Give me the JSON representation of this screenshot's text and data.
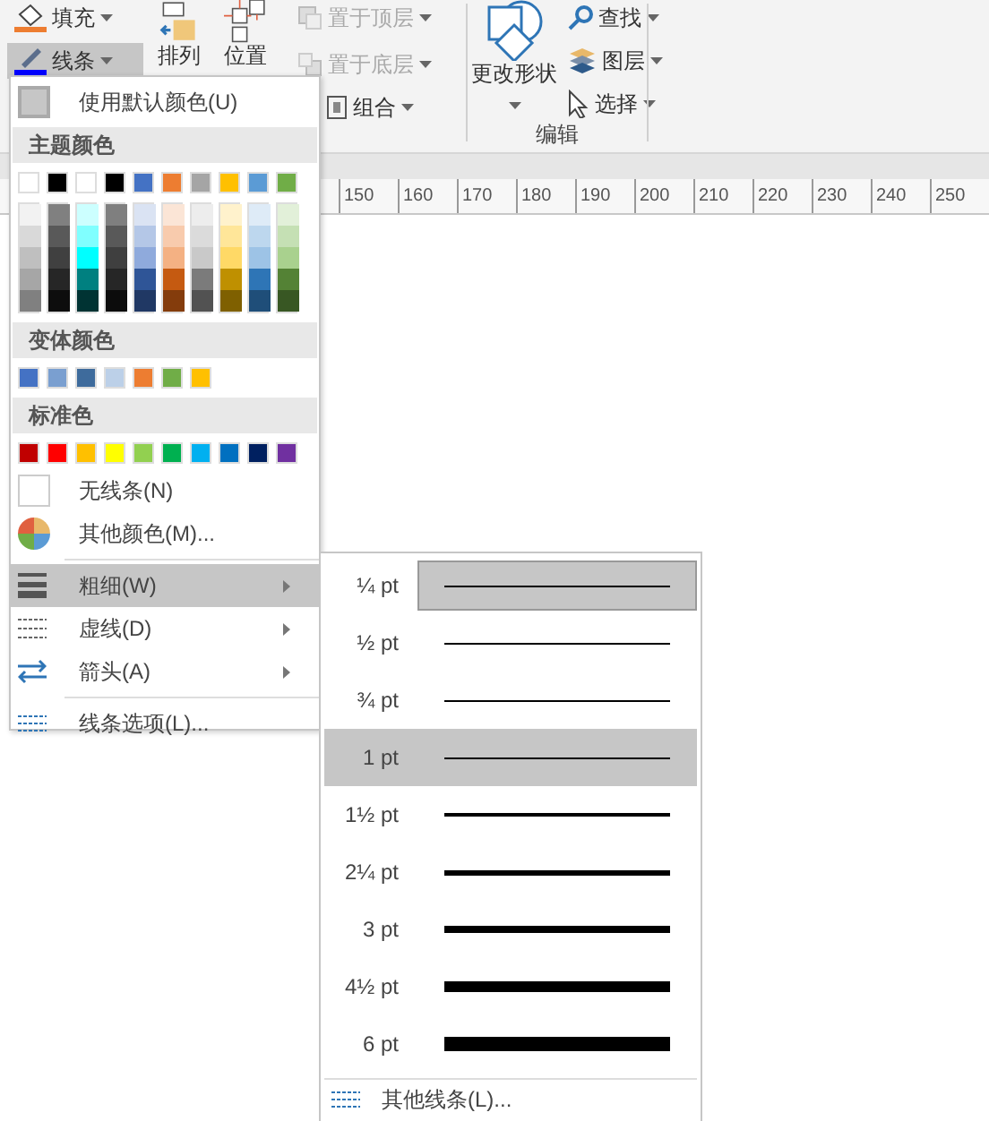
{
  "ribbon": {
    "format_buttons": [
      {
        "label": "填充",
        "kind": "fill",
        "selected": false
      },
      {
        "label": "线条",
        "kind": "line",
        "selected": true
      }
    ],
    "arrange_group": {
      "large_buttons": [
        {
          "label": "排列",
          "kind": "arrange"
        },
        {
          "label": "位置",
          "kind": "position"
        }
      ],
      "small_buttons": [
        {
          "label": "置于顶层",
          "kind": "front",
          "disabled": true
        },
        {
          "label": "置于底层",
          "kind": "back",
          "disabled": true
        },
        {
          "label": "组合",
          "kind": "group",
          "disabled": false
        }
      ]
    },
    "edit_group": {
      "label": "编辑",
      "large_button": {
        "label": "更改形状"
      },
      "small_buttons": [
        {
          "label": "查找",
          "kind": "find"
        },
        {
          "label": "图层",
          "kind": "layers"
        },
        {
          "label": "选择",
          "kind": "select"
        }
      ]
    }
  },
  "ruler": {
    "labels": [
      "150",
      "160",
      "170",
      "180",
      "190",
      "200",
      "210",
      "220",
      "230",
      "240",
      "250"
    ]
  },
  "line_menu": {
    "default_color": {
      "label": "使用默认颜色(U)"
    },
    "sections": [
      {
        "header": "主题颜色",
        "swatches": [
          {
            "color": "#ffffff"
          },
          {
            "color": "#000000"
          },
          {
            "color": "#ffffff"
          },
          {
            "color": "#000000"
          },
          {
            "color": "#4472c4"
          },
          {
            "color": "#ed7d31"
          },
          {
            "color": "#a5a5a5"
          },
          {
            "color": "#ffc000"
          },
          {
            "color": "#5b9bd5"
          },
          {
            "color": "#70ad47"
          }
        ],
        "shades": [
          {
            "swatches": [
              {
                "color": "#f2f2f2"
              },
              {
                "color": "#d9d9d9"
              },
              {
                "color": "#bfbfbf"
              },
              {
                "color": "#a6a6a6"
              },
              {
                "color": "#808080"
              }
            ]
          },
          {
            "swatches": [
              {
                "color": "#808080"
              },
              {
                "color": "#595959"
              },
              {
                "color": "#404040"
              },
              {
                "color": "#262626"
              },
              {
                "color": "#0d0d0d"
              }
            ]
          },
          {
            "swatches": [
              {
                "color": "#ccffff"
              },
              {
                "color": "#80ffff"
              },
              {
                "color": "#00ffff"
              },
              {
                "color": "#008080"
              },
              {
                "color": "#003333"
              }
            ]
          },
          {
            "swatches": [
              {
                "color": "#7f7f7f"
              },
              {
                "color": "#595959"
              },
              {
                "color": "#3f3f3f"
              },
              {
                "color": "#262626"
              },
              {
                "color": "#0c0c0c"
              }
            ]
          },
          {
            "swatches": [
              {
                "color": "#dae3f3"
              },
              {
                "color": "#b4c7e7"
              },
              {
                "color": "#8faadc"
              },
              {
                "color": "#2f5597"
              },
              {
                "color": "#203864"
              }
            ]
          },
          {
            "swatches": [
              {
                "color": "#fbe5d6"
              },
              {
                "color": "#f8cbad"
              },
              {
                "color": "#f4b183"
              },
              {
                "color": "#c55a11"
              },
              {
                "color": "#843c0c"
              }
            ]
          },
          {
            "swatches": [
              {
                "color": "#ededed"
              },
              {
                "color": "#dbdbdb"
              },
              {
                "color": "#c9c9c9"
              },
              {
                "color": "#7b7b7b"
              },
              {
                "color": "#525252"
              }
            ]
          },
          {
            "swatches": [
              {
                "color": "#fff2cc"
              },
              {
                "color": "#ffe699"
              },
              {
                "color": "#ffd966"
              },
              {
                "color": "#bf9000"
              },
              {
                "color": "#7f6000"
              }
            ]
          },
          {
            "swatches": [
              {
                "color": "#deebf7"
              },
              {
                "color": "#bdd7ee"
              },
              {
                "color": "#9dc3e6"
              },
              {
                "color": "#2e75b6"
              },
              {
                "color": "#1f4e79"
              }
            ]
          },
          {
            "swatches": [
              {
                "color": "#e2f0d9"
              },
              {
                "color": "#c5e0b4"
              },
              {
                "color": "#a9d18e"
              },
              {
                "color": "#548235"
              },
              {
                "color": "#385723"
              }
            ]
          }
        ]
      },
      {
        "header": "变体颜色",
        "swatches": [
          {
            "color": "#4472c4"
          },
          {
            "color": "#7a9fd0"
          },
          {
            "color": "#3e6b9c"
          },
          {
            "color": "#bcd0e8"
          },
          {
            "color": "#ed7d31"
          },
          {
            "color": "#70ad47"
          },
          {
            "color": "#ffc000"
          }
        ]
      },
      {
        "header": "标准色",
        "swatches": [
          {
            "color": "#c00000"
          },
          {
            "color": "#ff0000"
          },
          {
            "color": "#ffc000"
          },
          {
            "color": "#ffff00"
          },
          {
            "color": "#92d050"
          },
          {
            "color": "#00b050"
          },
          {
            "color": "#00b0f0"
          },
          {
            "color": "#0070c0"
          },
          {
            "color": "#002060"
          },
          {
            "color": "#7030a0"
          }
        ]
      }
    ],
    "color_items": [
      {
        "label": "无线条(N)",
        "kind": "none"
      },
      {
        "label": "其他颜色(M)...",
        "kind": "more"
      }
    ],
    "items": [
      {
        "label": "粗细(W)",
        "kind": "weight",
        "selected": true,
        "submenu": true
      },
      {
        "label": "虚线(D)",
        "kind": "dash",
        "selected": false,
        "submenu": true
      },
      {
        "label": "箭头(A)",
        "kind": "arrow",
        "selected": false,
        "submenu": true
      }
    ],
    "options": {
      "label": "线条选项(L)..."
    }
  },
  "weight_menu": {
    "items": [
      {
        "label": "¼ pt",
        "kind": "hairline",
        "current": true,
        "hovered": false
      },
      {
        "label": "½ pt",
        "kind": "hairline",
        "current": false,
        "hovered": false
      },
      {
        "label": "¾ pt",
        "kind": "hairline",
        "current": false,
        "hovered": false
      },
      {
        "label": "1 pt",
        "kind": "hairline",
        "current": false,
        "hovered": true
      },
      {
        "label": "1½ pt",
        "kind": "thin",
        "current": false,
        "hovered": false
      },
      {
        "label": "2¼ pt",
        "kind": "medium",
        "current": false,
        "hovered": false
      },
      {
        "label": "3 pt",
        "kind": "thick",
        "current": false,
        "hovered": false
      },
      {
        "label": "4½ pt",
        "kind": "heavy",
        "current": false,
        "hovered": false
      },
      {
        "label": "6 pt",
        "kind": "bold",
        "current": false,
        "hovered": false
      }
    ],
    "more": {
      "label": "其他线条(L)..."
    }
  }
}
